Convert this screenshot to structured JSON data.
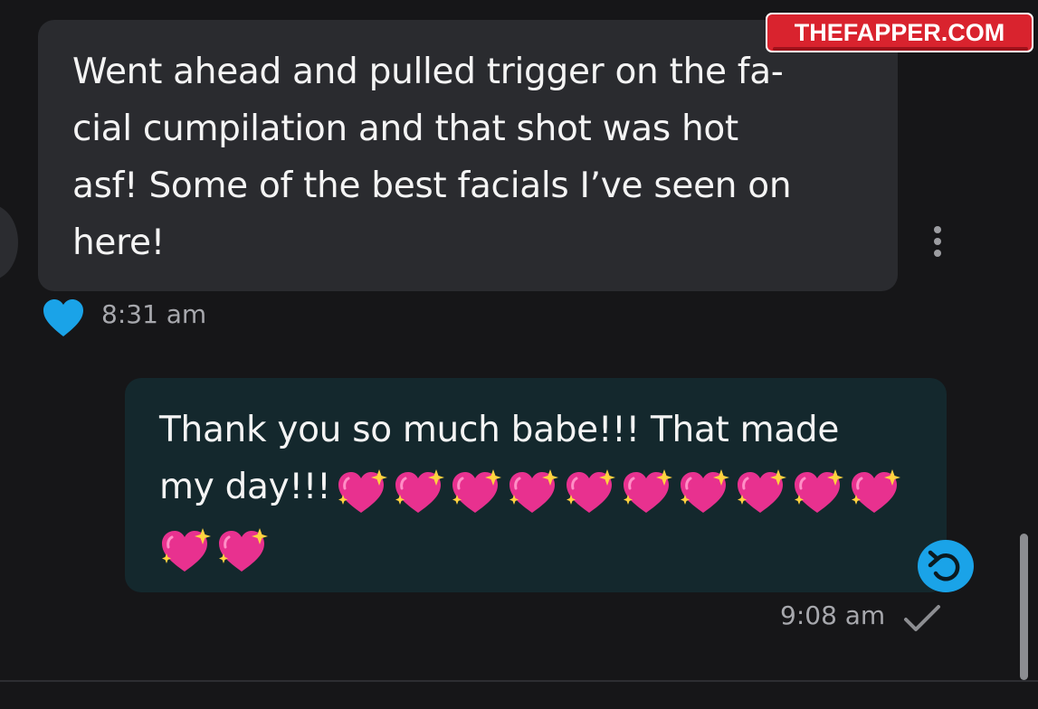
{
  "messages": {
    "incoming": {
      "lines": [
        "Went ahead and pulled trigger on the fa-",
        "cial cumpilation and that shot was hot",
        "asf! Some of the best facials I’ve seen on",
        "here!"
      ],
      "time": "8:31 am",
      "reaction_icon": "blue-heart-icon"
    },
    "outgoing": {
      "lines": [
        "Thank you so much babe!!! That made",
        "my day!!!"
      ],
      "emoji_name": "sparkling-heart",
      "emoji_count": 12,
      "time": "9:08 am",
      "status_icon": "check-icon"
    }
  },
  "watermark": {
    "text": "THEFAPPER.COM"
  },
  "colors": {
    "background": "#161618",
    "incoming_bubble": "#2a2b2f",
    "outgoing_bubble": "#14282d",
    "accent_blue": "#1aa3e8",
    "watermark_red": "#d9232e"
  }
}
